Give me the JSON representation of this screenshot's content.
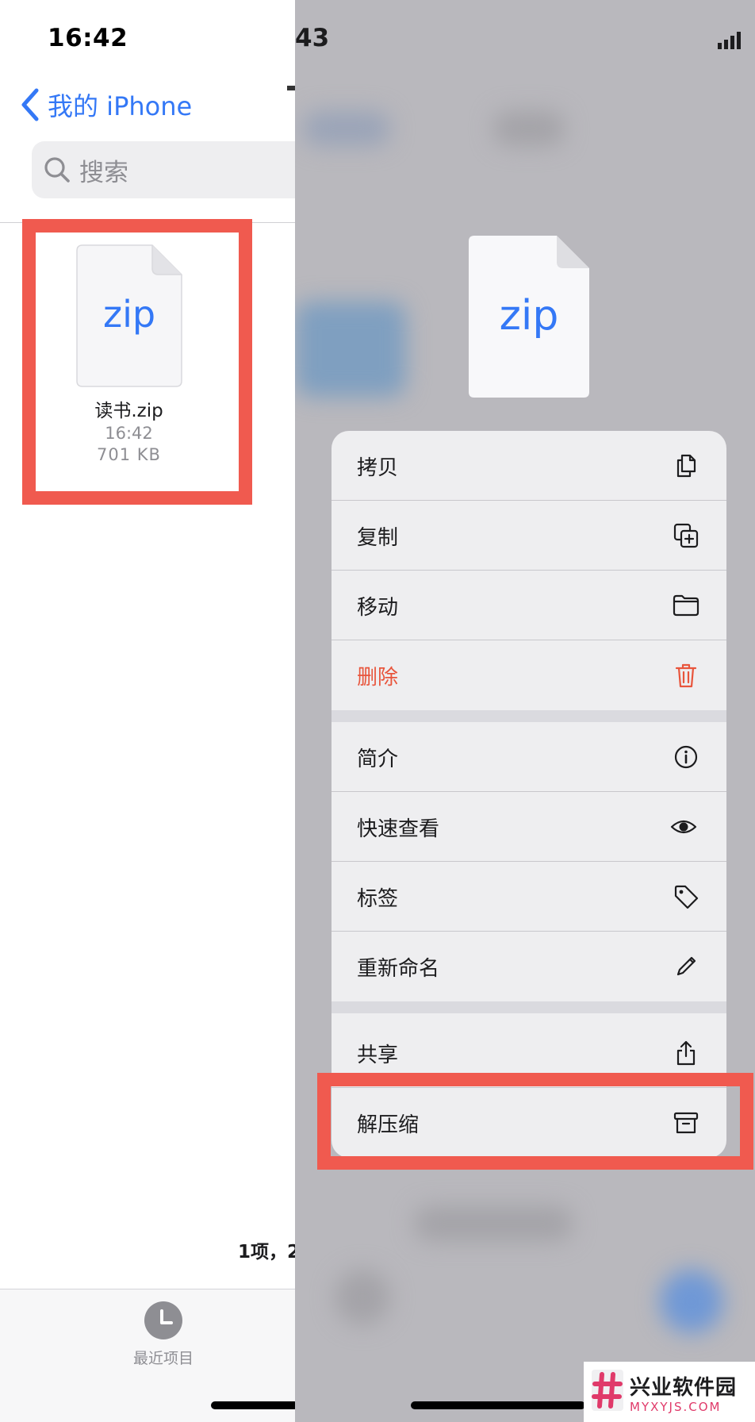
{
  "left_panel": {
    "status_time": "16:42",
    "nav": {
      "back_label": "我的 iPhone"
    },
    "search": {
      "placeholder": "搜索"
    },
    "file": {
      "icon_text": "zip",
      "name": "读书.zip",
      "time": "16:42",
      "size": "701 KB"
    },
    "footer_count": "1项，2",
    "tab_bar": {
      "recent_label": "最近项目"
    }
  },
  "right_panel": {
    "status_time_fragment": "43",
    "preview": {
      "icon_text": "zip"
    },
    "context_menu": [
      {
        "label": "拷贝",
        "icon": "copy-icon"
      },
      {
        "label": "复制",
        "icon": "duplicate-icon"
      },
      {
        "label": "移动",
        "icon": "folder-icon"
      },
      {
        "label": "删除",
        "icon": "trash-icon",
        "destructive": true
      },
      {
        "label": "简介",
        "icon": "info-icon"
      },
      {
        "label": "快速查看",
        "icon": "eye-icon"
      },
      {
        "label": "标签",
        "icon": "tag-icon"
      },
      {
        "label": "重新命名",
        "icon": "pencil-icon"
      },
      {
        "label": "共享",
        "icon": "share-icon"
      },
      {
        "label": "解压缩",
        "icon": "archive-icon"
      }
    ]
  },
  "watermark": {
    "title": "兴业软件园",
    "url": "MYXYJS.COM"
  },
  "colors": {
    "accent": "#3478f6",
    "highlight": "#f05a4f",
    "destructive": "#e8553c",
    "dim_overlay": "#b9b8bd"
  }
}
